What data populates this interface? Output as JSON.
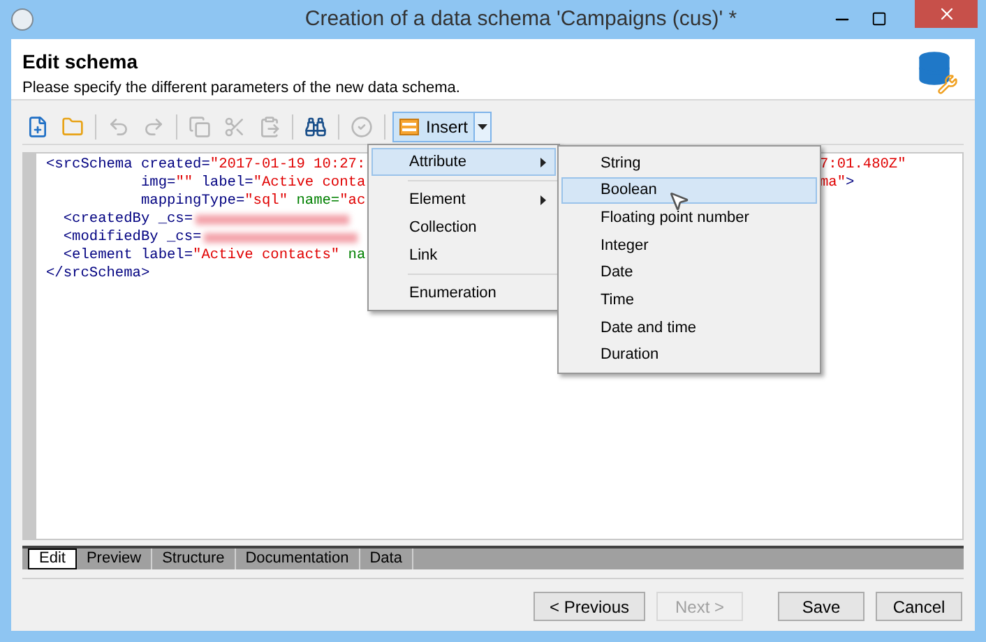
{
  "window": {
    "title": "Creation of a data schema 'Campaigns (cus)' *"
  },
  "header": {
    "title": "Edit schema",
    "subtitle": "Please specify the different parameters of the new data schema."
  },
  "toolbar": {
    "tools": [
      {
        "kind": "new",
        "disabled": false
      },
      {
        "kind": "open",
        "disabled": false
      },
      {
        "kind": "sep"
      },
      {
        "kind": "undo",
        "disabled": true
      },
      {
        "kind": "redo",
        "disabled": true
      },
      {
        "kind": "sep"
      },
      {
        "kind": "copy",
        "disabled": true
      },
      {
        "kind": "cut",
        "disabled": true
      },
      {
        "kind": "paste",
        "disabled": true
      },
      {
        "kind": "sep"
      },
      {
        "kind": "find",
        "disabled": false
      },
      {
        "kind": "sep"
      },
      {
        "kind": "check",
        "disabled": true
      },
      {
        "kind": "sep"
      }
    ],
    "insert": {
      "label": "Insert",
      "pressed": true
    }
  },
  "code": {
    "lines": [
      {
        "left": [
          {
            "t": "<srcSchema created=",
            "kind": "tag"
          },
          {
            "t": "\"2017-01-19 10:27:",
            "kind": "str"
          }
        ],
        "right": [
          {
            "t": "7:01.480Z\"",
            "kind": "str"
          }
        ]
      },
      {
        "left": [
          {
            "t": "           img=",
            "kind": "tag"
          },
          {
            "t": "\"\"",
            "kind": "str"
          },
          {
            "t": " label=",
            "kind": "tag"
          },
          {
            "t": "\"Active conta",
            "kind": "str"
          }
        ],
        "right": [
          {
            "t": "ma\"",
            "kind": "str"
          },
          {
            "t": ">",
            "kind": "tag"
          }
        ]
      },
      {
        "left": [
          {
            "t": "           mappingType=",
            "kind": "tag"
          },
          {
            "t": "\"sql\"",
            "kind": "str"
          },
          {
            "t": " name=",
            "kind": "attr"
          },
          {
            "t": "\"ac",
            "kind": "str"
          }
        ]
      },
      {
        "left": [
          {
            "t": "  <createdBy _cs=",
            "kind": "tag"
          }
        ],
        "redacted": true
      },
      {
        "left": [
          {
            "t": "  <modifiedBy _cs=",
            "kind": "tag"
          }
        ],
        "redacted": true
      },
      {
        "left": [
          {
            "t": "  <element label=",
            "kind": "tag"
          },
          {
            "t": "\"Active contacts\"",
            "kind": "str"
          },
          {
            "t": " na",
            "kind": "attr"
          }
        ]
      },
      {
        "left": [
          {
            "t": "</srcSchema>",
            "kind": "tag"
          }
        ]
      }
    ]
  },
  "menu": {
    "items": [
      {
        "kind": "item",
        "label": "Attribute",
        "submenu": true,
        "selected": true
      },
      {
        "kind": "sep"
      },
      {
        "kind": "item",
        "label": "Element",
        "submenu": true,
        "selected": false
      },
      {
        "kind": "item",
        "label": "Collection",
        "submenu": false,
        "selected": false
      },
      {
        "kind": "item",
        "label": "Link",
        "submenu": false,
        "selected": false
      },
      {
        "kind": "sep"
      },
      {
        "kind": "item",
        "label": "Enumeration",
        "submenu": false,
        "selected": false
      }
    ]
  },
  "submenu": {
    "items": [
      {
        "label": "String",
        "selected": false
      },
      {
        "label": "Boolean",
        "selected": true
      },
      {
        "label": "Floating point number",
        "selected": false
      },
      {
        "label": "Integer",
        "selected": false
      },
      {
        "label": "Date",
        "selected": false
      },
      {
        "label": "Time",
        "selected": false
      },
      {
        "label": "Date and time",
        "selected": false
      },
      {
        "label": "Duration",
        "selected": false
      }
    ]
  },
  "tabs": [
    {
      "label": "Edit",
      "selected": true
    },
    {
      "label": "Preview",
      "selected": false
    },
    {
      "label": "Structure",
      "selected": false
    },
    {
      "label": "Documentation",
      "selected": false
    },
    {
      "label": "Data",
      "selected": false
    }
  ],
  "buttons": [
    {
      "label": "< Previous",
      "disabled": false
    },
    {
      "label": "Next >",
      "disabled": true
    },
    {
      "label": "Save",
      "disabled": false
    },
    {
      "label": "Cancel",
      "disabled": false
    }
  ]
}
